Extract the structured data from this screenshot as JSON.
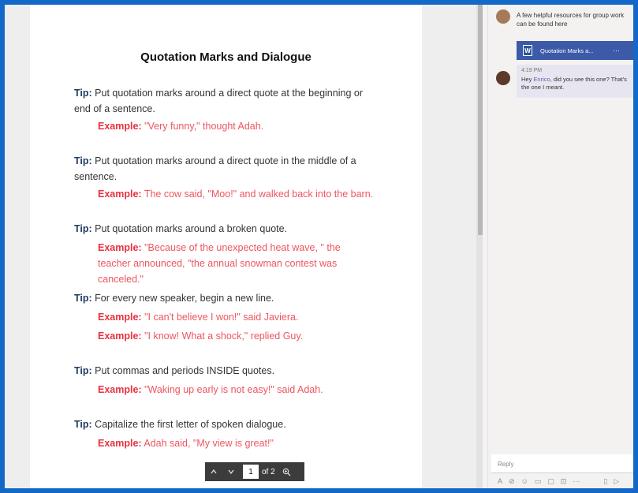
{
  "document": {
    "title": "Quotation Marks and Dialogue",
    "tip_label": "Tip:",
    "example_label": "Example:",
    "tips": [
      {
        "text": "Put quotation marks around a direct quote at the beginning or end of a sentence.",
        "examples": [
          "\"Very funny,\" thought Adah."
        ]
      },
      {
        "text": "Put quotation marks around a direct quote in the middle of a sentence.",
        "examples": [
          "The cow said, \"Moo!\" and walked back into the barn."
        ]
      },
      {
        "text": "Put quotation marks around a broken quote.",
        "examples": [
          "\"Because of the unexpected heat wave, \" the teacher announced, \"the annual snowman contest was canceled.\""
        ]
      },
      {
        "text": "For every new speaker, begin a new line.",
        "examples": [
          "\"I can't believe I won!\" said Javiera.",
          "\"I know! What a shock,\" replied Guy."
        ]
      },
      {
        "text": "Put commas and periods INSIDE quotes.",
        "examples": [
          "\"Waking up early is not easy!\" said Adah."
        ]
      },
      {
        "text": "Capitalize the first letter of spoken dialogue.",
        "examples": [
          "Adah said, \"My view is great!\""
        ]
      }
    ]
  },
  "pager": {
    "page": "1",
    "of": "of 2"
  },
  "chat": {
    "message1": "A few helpful resources for group work can be found here",
    "file_name": "Quotation Marks a...",
    "file_more": "···",
    "message2_time": "4:19 PM",
    "message2_prefix": "Hey ",
    "message2_mention": "Enrico",
    "message2_rest": ", did you see this one? That's the one I meant.",
    "reply_placeholder": "Reply"
  },
  "colors": {
    "frame": "#1469c8",
    "tip_label": "#1f3a5f",
    "example": "#e8323f",
    "mention": "#6264a7"
  }
}
